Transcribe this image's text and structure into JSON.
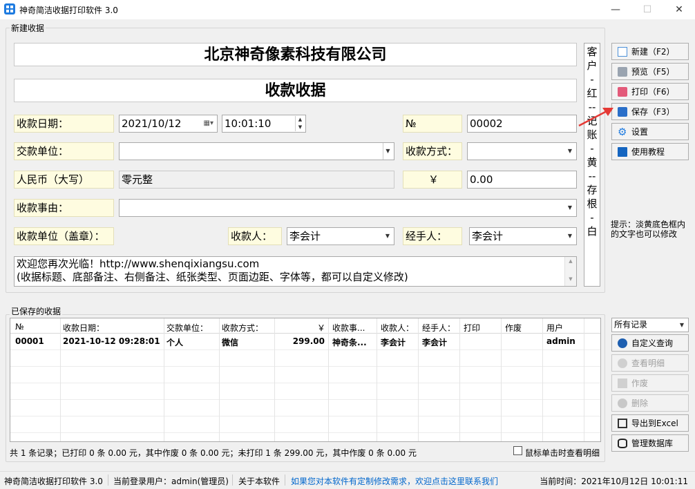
{
  "window": {
    "title": "神奇简洁收据打印软件 3.0",
    "minimize": "—",
    "maximize": "☐",
    "close": "✕"
  },
  "new_receipt": {
    "group_label": "新建收据",
    "company": "北京神奇像素科技有限公司",
    "doc_title": "收款收据",
    "date_label": "收款日期：",
    "date_value": "2021/10/12",
    "time_value": "10:01:10",
    "no_label": "№",
    "no_value": "00002",
    "payer_label": "交款单位：",
    "payer_value": "",
    "method_label": "收款方式：",
    "method_value": "",
    "rmb_label": "人民币（大写）",
    "rmb_value": "零元整",
    "yen_label": "￥",
    "amount_value": "0.00",
    "reason_label": "收款事由：",
    "reason_value": "",
    "stamp_label": "收款单位（盖章）：",
    "receiver_label": "收款人：",
    "receiver_value": "李会计",
    "handler_label": "经手人：",
    "handler_value": "李会计",
    "note_line1": "欢迎您再次光临！http://www.shenqixiangsu.com",
    "note_line2": "(收据标题、底部备注、右侧备注、纸张类型、页面边距、字体等，都可以自定义修改)",
    "side_note": [
      "客",
      "户",
      "-",
      "红",
      "--",
      "记",
      "账",
      "-",
      "黄",
      "--",
      "存",
      "根",
      "-",
      "白"
    ]
  },
  "right_buttons": {
    "new": "新建（F2）",
    "preview": "预览（F5）",
    "print": "打印（F6）",
    "save": "保存（F3）",
    "settings": "设置",
    "tutorial": "使用教程",
    "hint": "提示：淡黄底色框内的文字也可以修改"
  },
  "saved": {
    "group_label": "已保存的收据",
    "columns": [
      "№",
      "收款日期：",
      "交款单位：",
      "收款方式：",
      "￥",
      "收款事...",
      "收款人：",
      "经手人：",
      "打印",
      "作废",
      "用户"
    ],
    "rows": [
      [
        "00001",
        "2021-10-12 09:28:01",
        "个人",
        "微信",
        "299.00",
        "神奇条...",
        "李会计",
        "李会计",
        "",
        "",
        "admin"
      ]
    ],
    "summary": "共 1 条记录；已打印 0 条 0.00 元，其中作废 0 条 0.00 元；未打印 1 条 299.00 元，其中作废 0 条 0.00 元",
    "checkbox_label": "鼠标单击时查看明细"
  },
  "saved_buttons": {
    "filter": "所有记录",
    "custom_query": "自定义查询",
    "view_detail": "查看明细",
    "void": "作废",
    "delete": "删除",
    "export": "导出到Excel",
    "manage_db": "管理数据库"
  },
  "statusbar": {
    "app": "神奇简洁收据打印软件 3.0",
    "user": "当前登录用户：admin(管理员)",
    "about": "关于本软件",
    "link": "如果您对本软件有定制修改需求，欢迎点击这里联系我们",
    "time": "当前时间：2021年10月12日 10:01:11"
  },
  "colors": {
    "accent_blue": "#1e7be0",
    "label_yellow": "#fefce0",
    "arrow_red": "#e53935",
    "link_blue": "#0066cc"
  }
}
